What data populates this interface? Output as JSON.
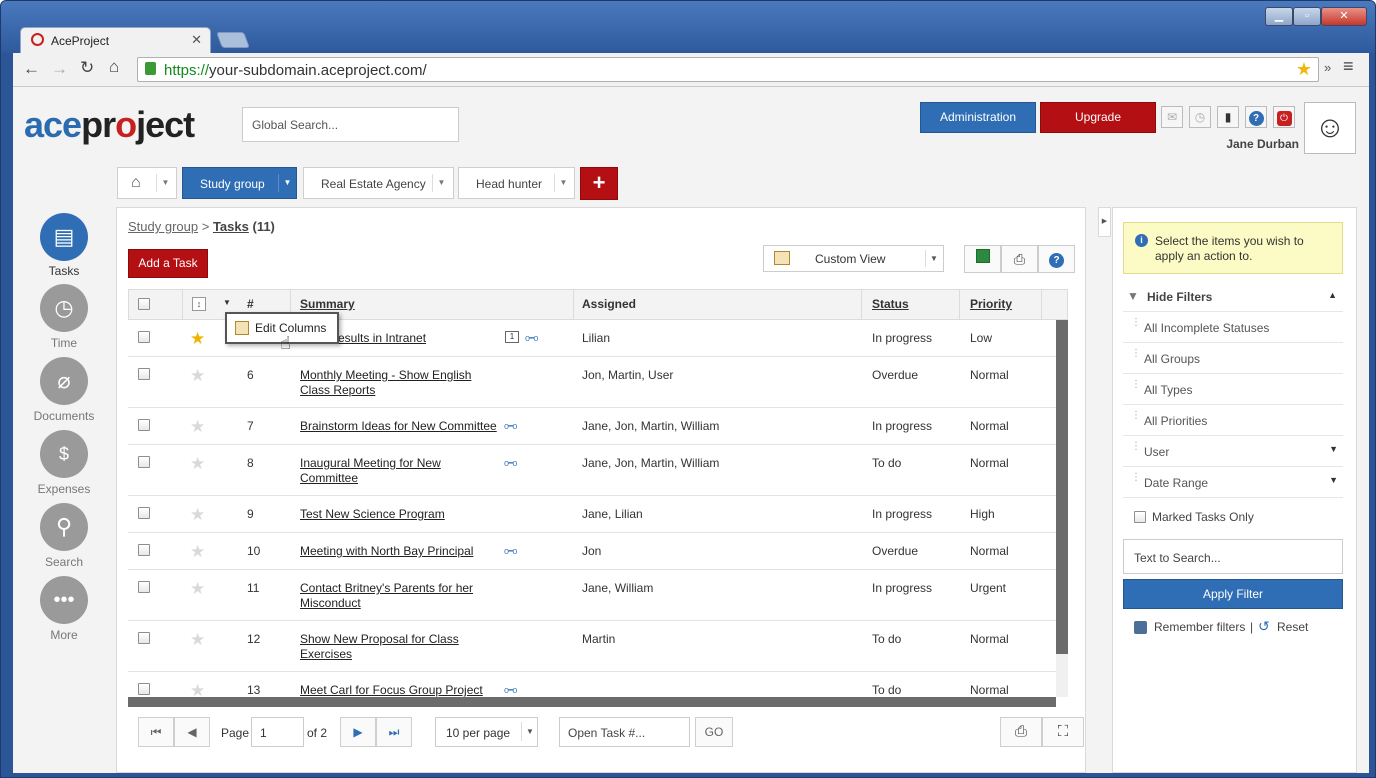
{
  "browser": {
    "tab_title": "AceProject",
    "url_scheme": "https://",
    "url_rest": "your-subdomain.aceproject.com/"
  },
  "header": {
    "logo_a": "ace",
    "logo_b": "pr",
    "logo_c": "ject",
    "search_placeholder": "Global Search...",
    "admin_label": "Administration",
    "upgrade_label": "Upgrade",
    "user_name": "Jane Durban"
  },
  "project_tabs": [
    {
      "label": "Study group"
    },
    {
      "label": "Real Estate Agency"
    },
    {
      "label": "Head hunter"
    }
  ],
  "sidebar": [
    {
      "label": "Tasks",
      "icon": "document-icon"
    },
    {
      "label": "Time",
      "icon": "clock-icon"
    },
    {
      "label": "Documents",
      "icon": "paperclip-icon"
    },
    {
      "label": "Expenses",
      "icon": "money-bag-icon"
    },
    {
      "label": "Search",
      "icon": "search-icon"
    },
    {
      "label": "More",
      "icon": "ellipsis-icon"
    }
  ],
  "breadcrumb": {
    "project": "Study group",
    "sep": ">",
    "section": "Tasks",
    "count": "(11)"
  },
  "add_task_label": "Add a Task",
  "view_select": "Custom View",
  "context_menu": {
    "label": "Edit Columns"
  },
  "columns": {
    "num": "#",
    "summary": "Summary",
    "assigned": "Assigned",
    "status": "Status",
    "priority": "Priority"
  },
  "tasks": [
    {
      "num": "",
      "summary": "Final Results in Intranet",
      "summary2": "",
      "assigned": "Lilian",
      "status": "In progress",
      "priority": "Low",
      "starred": true
    },
    {
      "num": "6",
      "summary": "Monthly Meeting - Show English",
      "summary2": "Class Reports",
      "assigned": "Jon, Martin, User",
      "status": "Overdue",
      "priority": "Normal",
      "starred": false
    },
    {
      "num": "7",
      "summary": "Brainstorm Ideas for New Committee",
      "summary2": "",
      "assigned": "Jane, Jon, Martin, William",
      "status": "In progress",
      "priority": "Normal",
      "starred": false
    },
    {
      "num": "8",
      "summary": "Inaugural Meeting for New",
      "summary2": "Committee",
      "assigned": "Jane, Jon, Martin, William",
      "status": "To do",
      "priority": "Normal",
      "starred": false
    },
    {
      "num": "9",
      "summary": "Test New Science Program",
      "summary2": "",
      "assigned": "Jane, Lilian",
      "status": "In progress",
      "priority": "High",
      "starred": false
    },
    {
      "num": "10",
      "summary": "Meeting with North Bay Principal",
      "summary2": "",
      "assigned": "Jon",
      "status": "Overdue",
      "priority": "Normal",
      "starred": false
    },
    {
      "num": "11",
      "summary": "Contact Britney's Parents for her",
      "summary2": "Misconduct",
      "assigned": "Jane, William",
      "status": "In progress",
      "priority": "Urgent",
      "starred": false
    },
    {
      "num": "12",
      "summary": "Show New Proposal for Class",
      "summary2": "Exercises",
      "assigned": "Martin",
      "status": "To do",
      "priority": "Normal",
      "starred": false
    },
    {
      "num": "13",
      "summary": "Meet Carl for Focus Group Project",
      "summary2": "",
      "assigned": "",
      "status": "To do",
      "priority": "Normal",
      "starred": false
    }
  ],
  "pager": {
    "page_label": "Page",
    "page_value": "1",
    "of_label": "of 2",
    "per_page": "10 per page",
    "open_task_placeholder": "Open Task #...",
    "go_label": "GO"
  },
  "filters": {
    "info": "Select the items you wish to apply an action to.",
    "hide_label": "Hide Filters",
    "items": [
      "All Incomplete Statuses",
      "All Groups",
      "All Types",
      "All Priorities",
      "User",
      "Date Range"
    ],
    "marked_label": "Marked Tasks Only",
    "text_search_placeholder": "Text to Search...",
    "apply_label": "Apply Filter",
    "remember_label": "Remember filters",
    "sep": "|",
    "reset_label": "Reset"
  }
}
